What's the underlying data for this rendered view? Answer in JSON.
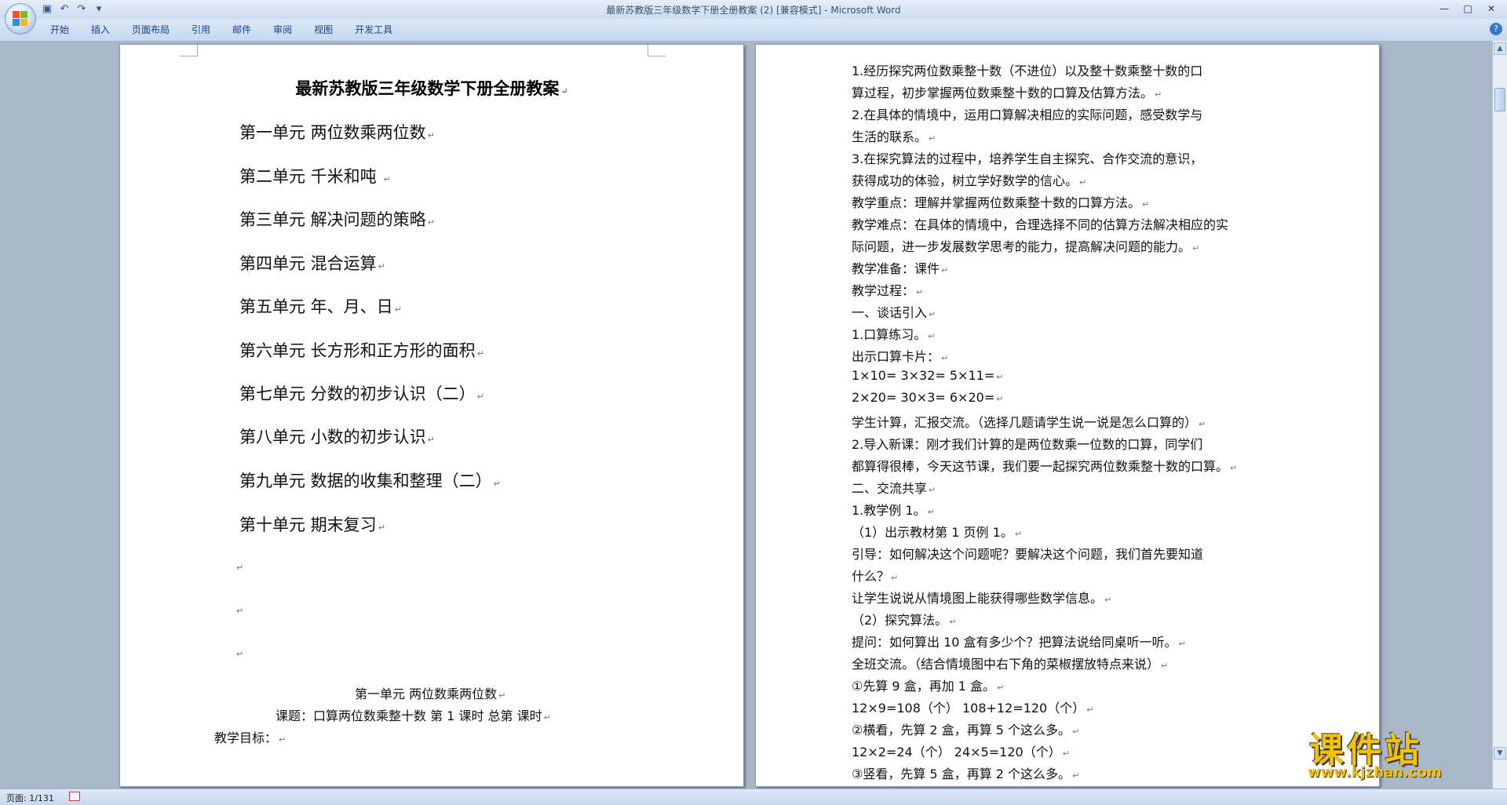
{
  "window": {
    "title": "最新苏教版三年级数学下册全册教案 (2) [兼容模式] - Microsoft Word",
    "controls": [
      "—",
      "□",
      "✕"
    ]
  },
  "quick_access": {
    "save": "save-icon",
    "undo": "undo-icon",
    "redo": "redo-icon",
    "customize": "▾"
  },
  "ribbon": {
    "tabs": [
      "开始",
      "插入",
      "页面布局",
      "引用",
      "邮件",
      "审阅",
      "视图",
      "开发工具"
    ],
    "help": "?"
  },
  "page1": {
    "title": "最新苏教版三年级数学下册全册教案",
    "units": [
      "第一单元  两位数乘两位数",
      "第二单元  千米和吨 ",
      "第三单元  解决问题的策略",
      "第四单元  混合运算",
      "第五单元  年、月、日",
      "第六单元  长方形和正方形的面积",
      "第七单元  分数的初步认识（二）",
      "第八单元  小数的初步认识",
      "第九单元  数据的收集和整理（二）",
      "第十单元  期末复习"
    ],
    "para_mark": "↵",
    "section_title": "第一单元  两位数乘两位数",
    "lesson_line": "课题：口算两位数乘整十数  第 1 课时  总第  课时",
    "goal_line": "教学目标："
  },
  "page2": {
    "lines": [
      "    1.经历探究两位数乘整十数（不进位）以及整十数乘整十数的口",
      "算过程，初步掌握两位数乘整十数的口算及估算方法。",
      "    2.在具体的情境中，运用口算解决相应的实际问题，感受数学与",
      "生活的联系。",
      "    3.在探究算法的过程中，培养学生自主探究、合作交流的意识，",
      "获得成功的体验，树立学好数学的信心。",
      "教学重点：理解并掌握两位数乘整十数的口算方法。",
      "教学难点：在具体的情境中，合理选择不同的估算方法解决相应的实",
      "际问题，进一步发展数学思考的能力，提高解决问题的能力。",
      "    教学准备：课件",
      "    教学过程：",
      "    一、谈话引入",
      "    1.口算练习。",
      "    出示口算卡片：",
      "    1×10=  3×32=  5×11=",
      "    2×20=  30×3=  6×20=",
      "    学生计算，汇报交流。（选择几题请学生说一说是怎么口算的）",
      "    2.导入新课：刚才我们计算的是两位数乘一位数的口算，同学们",
      "都算得很棒，今天这节课，我们要一起探究两位数乘整十数的口算。",
      "    二、交流共享",
      "    1.教学例 1。",
      "    （1）出示教材第 1 页例 1。",
      "    引导：如何解决这个问题呢？要解决这个问题，我们首先要知道",
      "什么？",
      "    让学生说说从情境图上能获得哪些数学信息。",
      "    （2）探究算法。",
      "    提问：如何算出 10 盒有多少个？把算法说给同桌听一听。",
      "    全班交流。（结合情境图中右下角的菜椒摆放特点来说）",
      "    ①先算 9 盒，再加 1 盒。",
      "    12×9=108（个）  108+12=120（个）",
      "    ②横看，先算 2 盒，再算 5 个这么多。",
      "    12×2=24（个）  24×5=120（个）",
      "    ③竖看，先算 5 盒，再算 2 个这么多。"
    ]
  },
  "status": {
    "page": "页面: 1/131"
  },
  "watermark": {
    "main": "课件站",
    "url": "www.kjzhan.com"
  }
}
